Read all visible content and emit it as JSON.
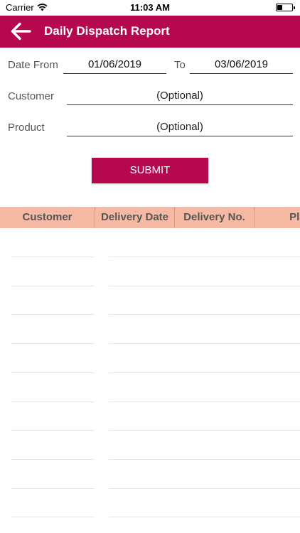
{
  "status_bar": {
    "carrier": "Carrier",
    "time": "11:03 AM",
    "battery_level": 0.35,
    "icons": [
      "wifi-icon",
      "battery-icon"
    ]
  },
  "header": {
    "title": "Daily Dispatch Report",
    "background_color": "#b5084f",
    "back_icon": "arrow-left-icon"
  },
  "form": {
    "date_from_label": "Date From",
    "date_from_value": "01/06/2019",
    "to_label": "To",
    "to_value": "03/06/2019",
    "customer_label": "Customer",
    "customer_value": "(Optional)",
    "product_label": "Product",
    "product_value": "(Optional)",
    "submit_label": "SUBMIT"
  },
  "table": {
    "header_color": "#f6b9a3",
    "columns": [
      "Customer",
      "Delivery Date",
      "Delivery No.",
      "Plan"
    ]
  }
}
